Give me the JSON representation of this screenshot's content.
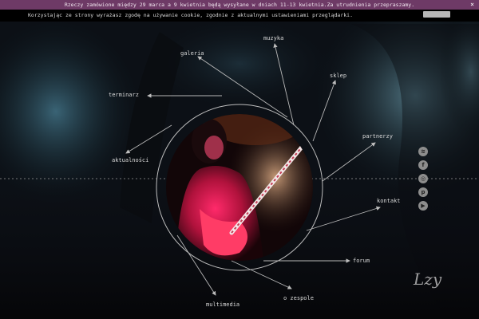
{
  "notice": {
    "text": "Rzeczy zamówione między 29 marca a 9 kwietnia będą wysyłane w dniach 11-13 kwietnia.Za utrudnienia przepraszamy.",
    "close_icon": "×"
  },
  "cookie": {
    "text": "Korzystając ze strony wyrażasz zgodę na używanie cookie, zgodnie z aktualnymi ustawieniami przeglądarki."
  },
  "nav": {
    "muzyka": "muzyka",
    "galeria": "galeria",
    "sklep": "sklep",
    "terminarz": "terminarz",
    "partnerzy": "partnerzy",
    "aktualnosci": "aktualności",
    "kontakt": "kontakt",
    "forum": "forum",
    "o_zespole": "o zespole",
    "multimedia": "multimedia"
  },
  "social": [
    {
      "name": "spotify-icon",
      "glyph": "≋"
    },
    {
      "name": "facebook-icon",
      "glyph": "f"
    },
    {
      "name": "instagram-icon",
      "glyph": "◎"
    },
    {
      "name": "pinterest-icon",
      "glyph": "p"
    },
    {
      "name": "youtube-icon",
      "glyph": "▶"
    }
  ],
  "colors": {
    "notice_bg": "#6e3a66",
    "accent_red": "#e0285c",
    "nav_text": "#d9d9d9"
  },
  "signature": "Lzy"
}
